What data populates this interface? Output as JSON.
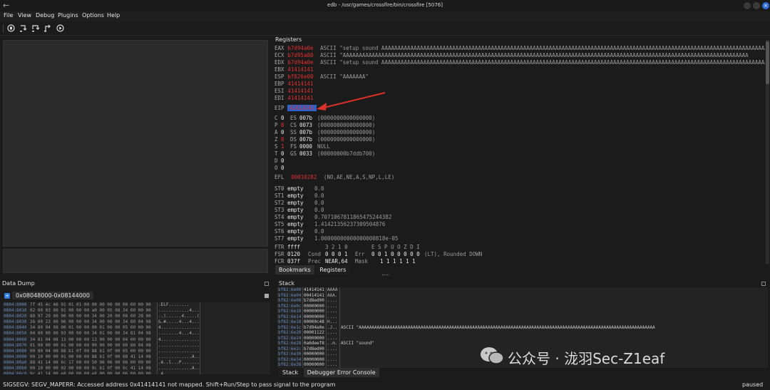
{
  "window": {
    "title": "edb - /usr/games/crossfire/bin/crossfire [5076]"
  },
  "menu": [
    "File",
    "View",
    "Debug",
    "Plugins",
    "Options",
    "Help"
  ],
  "registers": {
    "title": "Registers",
    "gp": [
      {
        "name": "EAX",
        "value": "b7d94a0e",
        "comment": "ASCII \"setup sound AAAAAAAAAAAAAAAAAAAAAAAAAAAAAAAAAAAAAAAAAAAAAAAAAAAAAAAAAAAAAAAAAAAAAAAAAAAAAAAAAAAAAAAAAAAAAAAAAAAAAAAAAAAAAAAAAAAAAAAA"
      },
      {
        "name": "ECX",
        "value": "b7d95a80",
        "comment": "ASCII \"AAAAAAAAAAAAAAAAAAAAAAAAAAAAAAAAAAAAAAAAAAAAAAAAAAAAAAAAAAAAAAAAAAAAAAAAAAAAAAAAAAAAAAAAAAAAAAAAAAAAAAAAAAAAAAAAAAAAAAAAAAAAAA"
      },
      {
        "name": "EDX",
        "value": "b7d94a0e",
        "comment": "ASCII \"setup sound AAAAAAAAAAAAAAAAAAAAAAAAAAAAAAAAAAAAAAAAAAAAAAAAAAAAAAAAAAAAAAAAAAAAAAAAAAAAAAAAAAAAAAAAAAAAAAAAAAAAAAAAAAAAAAAAAAAAAAAA"
      },
      {
        "name": "EBX",
        "value": "41414141",
        "comment": ""
      },
      {
        "name": "ESP",
        "value": "bf826e00",
        "comment": "ASCII \"AAAAAAA\""
      },
      {
        "name": "EBP",
        "value": "41414141",
        "comment": ""
      },
      {
        "name": "ESI",
        "value": "41414141",
        "comment": ""
      },
      {
        "name": "EDI",
        "value": "41414141",
        "comment": ""
      }
    ],
    "eip": {
      "name": "EIP",
      "value": "41414141"
    },
    "flags": [
      {
        "f": "C",
        "v": "0",
        "changed": false,
        "seg": "ES",
        "sv": "007b",
        "sc": "(0000000000000000)"
      },
      {
        "f": "P",
        "v": "0",
        "changed": true,
        "seg": "CS",
        "sv": "0073",
        "sc": "(0000000000000000)"
      },
      {
        "f": "A",
        "v": "0",
        "changed": false,
        "seg": "SS",
        "sv": "007b",
        "sc": "(0000000000000000)"
      },
      {
        "f": "Z",
        "v": "0",
        "changed": true,
        "seg": "DS",
        "sv": "007b",
        "sc": "(0000000000000000)"
      },
      {
        "f": "S",
        "v": "1",
        "changed": true,
        "seg": "FS",
        "sv": "0000",
        "sc": "NULL"
      },
      {
        "f": "T",
        "v": "0",
        "changed": false,
        "seg": "GS",
        "sv": "0033",
        "sc": "(00000000b7ddb700)"
      },
      {
        "f": "D",
        "v": "0",
        "changed": false,
        "seg": "",
        "sv": "",
        "sc": ""
      },
      {
        "f": "O",
        "v": "0",
        "changed": false,
        "seg": "",
        "sv": "",
        "sc": ""
      }
    ],
    "efl": {
      "name": "EFL",
      "value": "00010282",
      "comment": "(NO,AE,NE,A,S,NP,L,LE)"
    },
    "fpu": [
      {
        "name": "ST0",
        "state": "empty",
        "value": "0.0"
      },
      {
        "name": "ST1",
        "state": "empty",
        "value": "0.0"
      },
      {
        "name": "ST2",
        "state": "empty",
        "value": "0.0"
      },
      {
        "name": "ST3",
        "state": "empty",
        "value": "0.0"
      },
      {
        "name": "ST4",
        "state": "empty",
        "value": "0.7071067811865475244382"
      },
      {
        "name": "ST5",
        "state": "empty",
        "value": "1.41421356237309504876"
      },
      {
        "name": "ST6",
        "state": "empty",
        "value": "0.0"
      },
      {
        "name": "ST7",
        "state": "empty",
        "value": "1.00000000000000000818e-05"
      }
    ],
    "ftr": {
      "name": "FTR",
      "value": "ffff",
      "bits": "3  2  1  0",
      "flagbits": "E  S  P  U  O  Z  D  I"
    },
    "fsr": {
      "name": "FSR",
      "value": "0120",
      "cond_label": "Cond",
      "cond": "0  0  0  1",
      "err_label": "Err",
      "err": "0  0  1  0  0  0  0  0",
      "mode": "(LT), Rounded DOWN"
    },
    "fcr": {
      "name": "FCR",
      "value": "037f",
      "prec_label": "Prec",
      "prec": "NEAR,64",
      "mask_label": "Mask",
      "mask": "1  1  1  1  1  1"
    }
  },
  "bottom_tabs": [
    "Bookmarks",
    "Registers"
  ],
  "data_dump": {
    "title": "Data Dump",
    "tab": "0x08048000-0x08144000",
    "rows": [
      {
        "addr": "0804:8000",
        "hex": "7f 45 4c 46 01 01 01 00 00 00 00 00 00 00 00 00",
        "ascii": ".ELF........"
      },
      {
        "addr": "0804:8010",
        "hex": "02 00 03 00 01 00 00 00 a0 00 05 08 34 00 00 00",
        "ascii": "............4..."
      },
      {
        "addr": "0804:8020",
        "hex": "88 97 29 00 00 00 00 00 34 00 20 00 08 00 28 00",
        "ascii": "..)......4.....("
      },
      {
        "addr": "0804:8030",
        "hex": "26 00 23 00 06 00 00 00 34 00 00 00 34 80 04 08",
        "ascii": "&.#.....4...4..."
      },
      {
        "addr": "0804:8040",
        "hex": "34 80 04 08 00 01 00 00 00 01 00 00 05 00 00 00",
        "ascii": "4..............."
      },
      {
        "addr": "0804:8050",
        "hex": "04 00 00 00 03 00 00 00 34 01 00 00 34 81 04 08",
        "ascii": "........4...4..."
      },
      {
        "addr": "0804:8060",
        "hex": "34 81 04 08 13 00 00 00 13 00 00 00 04 00 00 00",
        "ascii": "4..............."
      },
      {
        "addr": "0804:8070",
        "hex": "01 00 00 00 01 00 00 00 00 00 00 00 00 80 04 08",
        "ascii": "................"
      },
      {
        "addr": "0804:8080",
        "hex": "00 80 04 08 88 b1 0f 00 88 b1 0f 00 05 00 00 00",
        "ascii": "................"
      },
      {
        "addr": "0804:8090",
        "hex": "00 10 00 00 01 00 00 00 88 b1 0f 00 88 41 14 08",
        "ascii": ".............A.."
      },
      {
        "addr": "0804:80a0",
        "hex": "88 41 14 08 6c 17 00 00 50 96 06 00 06 00 00 00",
        "ascii": ".A..l...P......."
      },
      {
        "addr": "0804:80b0",
        "hex": "00 10 00 00 02 00 00 00 9c b1 0f 00 9c 41 14 08",
        "ascii": ".............A.."
      },
      {
        "addr": "0804:80c0",
        "hex": "9c 41 14 08 e8 00 00 00 e8 00 00 00 06 00 00 00",
        "ascii": ".A.............."
      }
    ]
  },
  "stack": {
    "title": "Stack",
    "rows": [
      {
        "addr": "bf82:6e00",
        "val": "41414141",
        "asc": "AAAA",
        "cmt": ""
      },
      {
        "addr": "bf82:6e04",
        "val": "00414141",
        "asc": "AAA.",
        "cmt": ""
      },
      {
        "addr": "bf82:6e08",
        "val": "b7d8ed00",
        "asc": "....",
        "cmt": ""
      },
      {
        "addr": "bf82:6e0c",
        "val": "00000000",
        "asc": "....",
        "cmt": ""
      },
      {
        "addr": "bf82:6e10",
        "val": "00000000",
        "asc": "....",
        "cmt": ""
      },
      {
        "addr": "bf82:6e14",
        "val": "00000000",
        "asc": "....",
        "cmt": ""
      },
      {
        "addr": "bf82:6e18",
        "val": "00000c48",
        "asc": "H...",
        "cmt": ""
      },
      {
        "addr": "bf82:6e1c",
        "val": "b7d94a0e",
        "asc": ".J..",
        "cmt": "ASCII \"AAAAAAAAAAAAAAAAAAAAAAAAAAAAAAAAAAAAAAAAAAAAAAAAAAAAAAAAAAAAAAAAAAAAAAAAAAAAAAAAAAAAAAAAAAAAAAAAAAAAAAAAAAAAAAAAAAA"
      },
      {
        "addr": "bf82:6e20",
        "val": "00001122",
        "asc": "....",
        "cmt": ""
      },
      {
        "addr": "bf82:6e24",
        "val": "00000000",
        "asc": "....",
        "cmt": ""
      },
      {
        "addr": "bf82:6e28",
        "val": "0a6deef8",
        "asc": "..m.",
        "cmt": "ASCII \"sound\""
      },
      {
        "addr": "bf82:6e2c",
        "val": "b7d8ed00",
        "asc": "....",
        "cmt": ""
      },
      {
        "addr": "bf82:6e30",
        "val": "00000000",
        "asc": "....",
        "cmt": ""
      },
      {
        "addr": "bf82:6e34",
        "val": "00000000",
        "asc": "....",
        "cmt": ""
      },
      {
        "addr": "bf82:6e38",
        "val": "00000000",
        "asc": "....",
        "cmt": ""
      }
    ],
    "tabs": [
      "Stack",
      "Debugger Error Console"
    ]
  },
  "status": {
    "message": "SIGSEGV: SEGV_MAPERR: Accessed address 0x41414141 not mapped. Shift+Run/Step to pass signal to the program",
    "state": "paused"
  },
  "watermark": "公众号 · 泷羽Sec-Z1eaf",
  "colors": {
    "changed_red": "#e03030",
    "eip_highlight": "#2a62c9",
    "arrow_red": "#d9312a",
    "hex_addr": "#6b8fc2"
  },
  "icons": [
    "back-arrow-icon",
    "run-icon",
    "step-into-icon",
    "step-over-icon",
    "step-out-icon",
    "play-icon",
    "window-minimize-icon",
    "window-maximize-icon",
    "window-close-icon"
  ]
}
